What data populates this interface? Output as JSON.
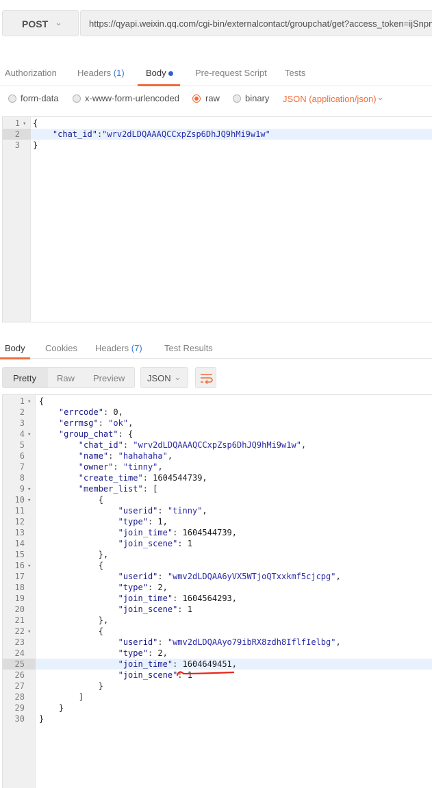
{
  "request": {
    "method": "POST",
    "url": "https://qyapi.weixin.qq.com/cgi-bin/externalcontact/groupchat/get?access_token=ijSnpnjU"
  },
  "request_tabs": [
    {
      "label": "Authorization"
    },
    {
      "label": "Headers",
      "count": "(1)"
    },
    {
      "label": "Body"
    },
    {
      "label": "Pre-request Script"
    },
    {
      "label": "Tests"
    }
  ],
  "body_types": {
    "form_data": "form-data",
    "urlencoded": "x-www-form-urlencoded",
    "raw": "raw",
    "binary": "binary",
    "content_type": "JSON (application/json)",
    "selected": "raw"
  },
  "request_body_lines": [
    {
      "n": "1",
      "t": "{"
    },
    {
      "n": "2",
      "t": "    \"chat_id\":\"wrv2dLDQAAAQCCxpZsp6DhJQ9hMi9w1w\""
    },
    {
      "n": "3",
      "t": "}"
    }
  ],
  "response_tabs": [
    {
      "label": "Body"
    },
    {
      "label": "Cookies"
    },
    {
      "label": "Headers",
      "count": "(7)"
    },
    {
      "label": "Test Results"
    }
  ],
  "response_toolbar": {
    "views": [
      "Pretty",
      "Raw",
      "Preview"
    ],
    "active_view": "Pretty",
    "format": "JSON"
  },
  "response_lines": [
    {
      "n": "1",
      "t": "{"
    },
    {
      "n": "2",
      "t": "    \"errcode\": 0,"
    },
    {
      "n": "3",
      "t": "    \"errmsg\": \"ok\","
    },
    {
      "n": "4",
      "t": "    \"group_chat\": {"
    },
    {
      "n": "5",
      "t": "        \"chat_id\": \"wrv2dLDQAAAQCCxpZsp6DhJQ9hMi9w1w\","
    },
    {
      "n": "6",
      "t": "        \"name\": \"hahahaha\","
    },
    {
      "n": "7",
      "t": "        \"owner\": \"tinny\","
    },
    {
      "n": "8",
      "t": "        \"create_time\": 1604544739,"
    },
    {
      "n": "9",
      "t": "        \"member_list\": ["
    },
    {
      "n": "10",
      "t": "            {"
    },
    {
      "n": "11",
      "t": "                \"userid\": \"tinny\","
    },
    {
      "n": "12",
      "t": "                \"type\": 1,"
    },
    {
      "n": "13",
      "t": "                \"join_time\": 1604544739,"
    },
    {
      "n": "14",
      "t": "                \"join_scene\": 1"
    },
    {
      "n": "15",
      "t": "            },"
    },
    {
      "n": "16",
      "t": "            {"
    },
    {
      "n": "17",
      "t": "                \"userid\": \"wmv2dLDQAA6yVX5WTjoQTxxkmf5cjcpg\","
    },
    {
      "n": "18",
      "t": "                \"type\": 2,"
    },
    {
      "n": "19",
      "t": "                \"join_time\": 1604564293,"
    },
    {
      "n": "20",
      "t": "                \"join_scene\": 1"
    },
    {
      "n": "21",
      "t": "            },"
    },
    {
      "n": "22",
      "t": "            {"
    },
    {
      "n": "23",
      "t": "                \"userid\": \"wmv2dLDQAAyo79ibRX8zdh8IflfIelbg\","
    },
    {
      "n": "24",
      "t": "                \"type\": 2,"
    },
    {
      "n": "25",
      "t": "                \"join_time\": 1604649451,"
    },
    {
      "n": "26",
      "t": "                \"join_scene\": 1"
    },
    {
      "n": "27",
      "t": "            }"
    },
    {
      "n": "28",
      "t": "        ]"
    },
    {
      "n": "29",
      "t": "    }"
    },
    {
      "n": "30",
      "t": "}"
    }
  ],
  "folds": [
    "1",
    "4",
    "9",
    "10",
    "16",
    "22"
  ],
  "highlighted_line": "25",
  "colors": {
    "accent": "#f26b3a",
    "link_blue": "#3a7bd5",
    "unsaved_dot": "#2a64c8",
    "annotation_red": "#e8261a"
  }
}
